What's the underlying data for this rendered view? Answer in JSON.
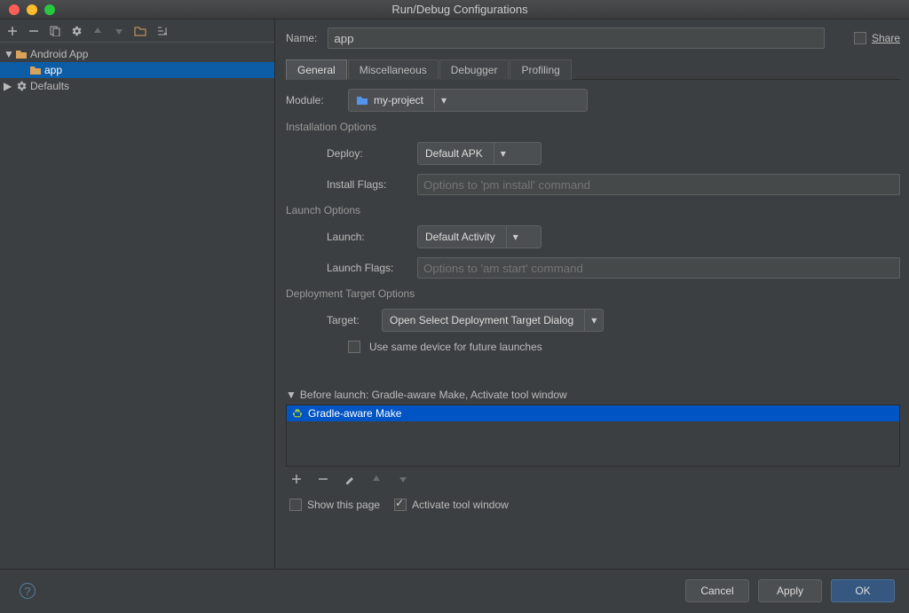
{
  "window": {
    "title": "Run/Debug Configurations"
  },
  "sidebar": {
    "items": [
      {
        "label": "Android App",
        "type": "folder",
        "expanded": true
      },
      {
        "label": "app",
        "type": "config"
      },
      {
        "label": "Defaults",
        "type": "defaults",
        "expanded": false
      }
    ]
  },
  "name_field": {
    "label": "Name:",
    "value": "app"
  },
  "share": {
    "label": "Share"
  },
  "tabs": {
    "items": [
      "General",
      "Miscellaneous",
      "Debugger",
      "Profiling"
    ],
    "active": 0
  },
  "module": {
    "label": "Module:",
    "value": "my-project"
  },
  "sections": {
    "install": {
      "title": "Installation Options",
      "deploy": {
        "label": "Deploy:",
        "value": "Default APK"
      },
      "install_flags": {
        "label": "Install Flags:",
        "placeholder": "Options to 'pm install' command"
      }
    },
    "launch": {
      "title": "Launch Options",
      "launch": {
        "label": "Launch:",
        "value": "Default Activity"
      },
      "launch_flags": {
        "label": "Launch Flags:",
        "placeholder": "Options to 'am start' command"
      }
    },
    "deploy": {
      "title": "Deployment Target Options",
      "target": {
        "label": "Target:",
        "value": "Open Select Deployment Target Dialog"
      },
      "same_device": "Use same device for future launches"
    }
  },
  "before_launch": {
    "header": "Before launch: Gradle-aware Make, Activate tool window",
    "items": [
      "Gradle-aware Make"
    ],
    "checks": {
      "show_page": "Show this page",
      "activate_tool": "Activate tool window"
    }
  },
  "footer": {
    "cancel": "Cancel",
    "apply": "Apply",
    "ok": "OK"
  }
}
